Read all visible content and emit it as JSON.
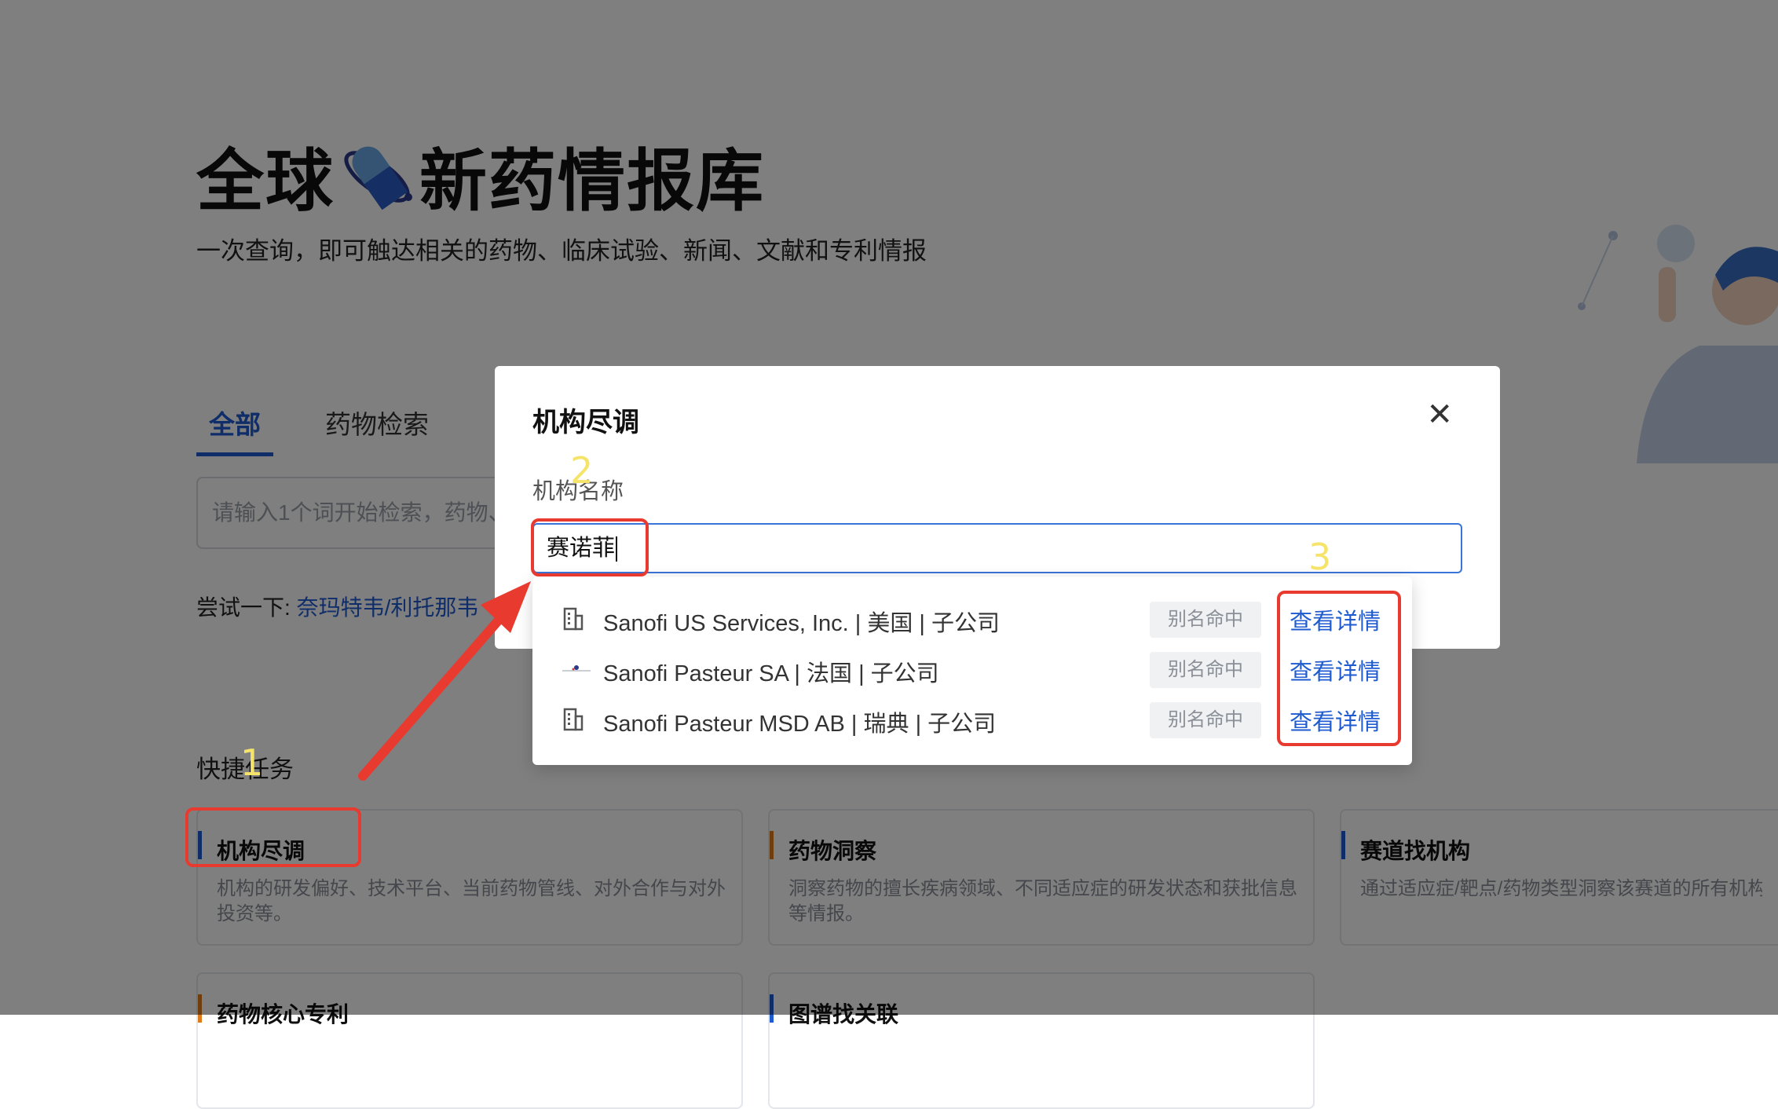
{
  "hero": {
    "title_left": "全球",
    "title_right": "新药情报库",
    "subtitle": "一次查询，即可触达相关的药物、临床试验、新闻、文献和专利情报"
  },
  "tabs": [
    {
      "label": "全部",
      "active": true
    },
    {
      "label": "药物检索",
      "active": false
    }
  ],
  "search": {
    "placeholder": "请输入1个词开始检索，药物、"
  },
  "try": {
    "label": "尝试一下:",
    "example": "奈玛特韦/利托那韦"
  },
  "quick_tasks": {
    "title": "快捷任务",
    "cards": [
      {
        "title": "机构尽调",
        "desc": "机构的研发偏好、技术平台、当前药物管线、对外合作与对外投资等。",
        "accent": "#1e5bd0"
      },
      {
        "title": "药物洞察",
        "desc": "洞察药物的擅长疾病领域、不同适应症的研发状态和获批信息等情报。",
        "accent": "#e07b1a"
      },
      {
        "title": "赛道找机构",
        "desc": "通过适应症/靶点/药物类型洞察该赛道的所有机构",
        "accent": "#1e5bd0"
      },
      {
        "title": "药物核心专利",
        "desc": "",
        "accent": "#e07b1a"
      },
      {
        "title": "图谱找关联",
        "desc": "",
        "accent": "#1e5bd0"
      }
    ]
  },
  "modal": {
    "title": "机构尽调",
    "close_icon": "close-icon",
    "field_label": "机构名称",
    "input_value": "赛诺菲",
    "results": [
      {
        "name": "Sanofi US Services, Inc. | 美国 | 子公司",
        "icon": "building-icon",
        "badge": "别名命中",
        "action": "查看详情"
      },
      {
        "name": "Sanofi Pasteur SA | 法国 | 子公司",
        "icon": "company-logo-icon",
        "badge": "别名命中",
        "action": "查看详情"
      },
      {
        "name": "Sanofi Pasteur MSD AB | 瑞典 | 子公司",
        "icon": "building-icon",
        "badge": "别名命中",
        "action": "查看详情"
      }
    ]
  },
  "annotations": {
    "step1": "1",
    "step2": "2",
    "step3": "3",
    "highlight_color": "#e83a2f",
    "number_color": "#f6e46a"
  },
  "colors": {
    "primary": "#1e5bd0",
    "accent_orange": "#e07b1a"
  }
}
